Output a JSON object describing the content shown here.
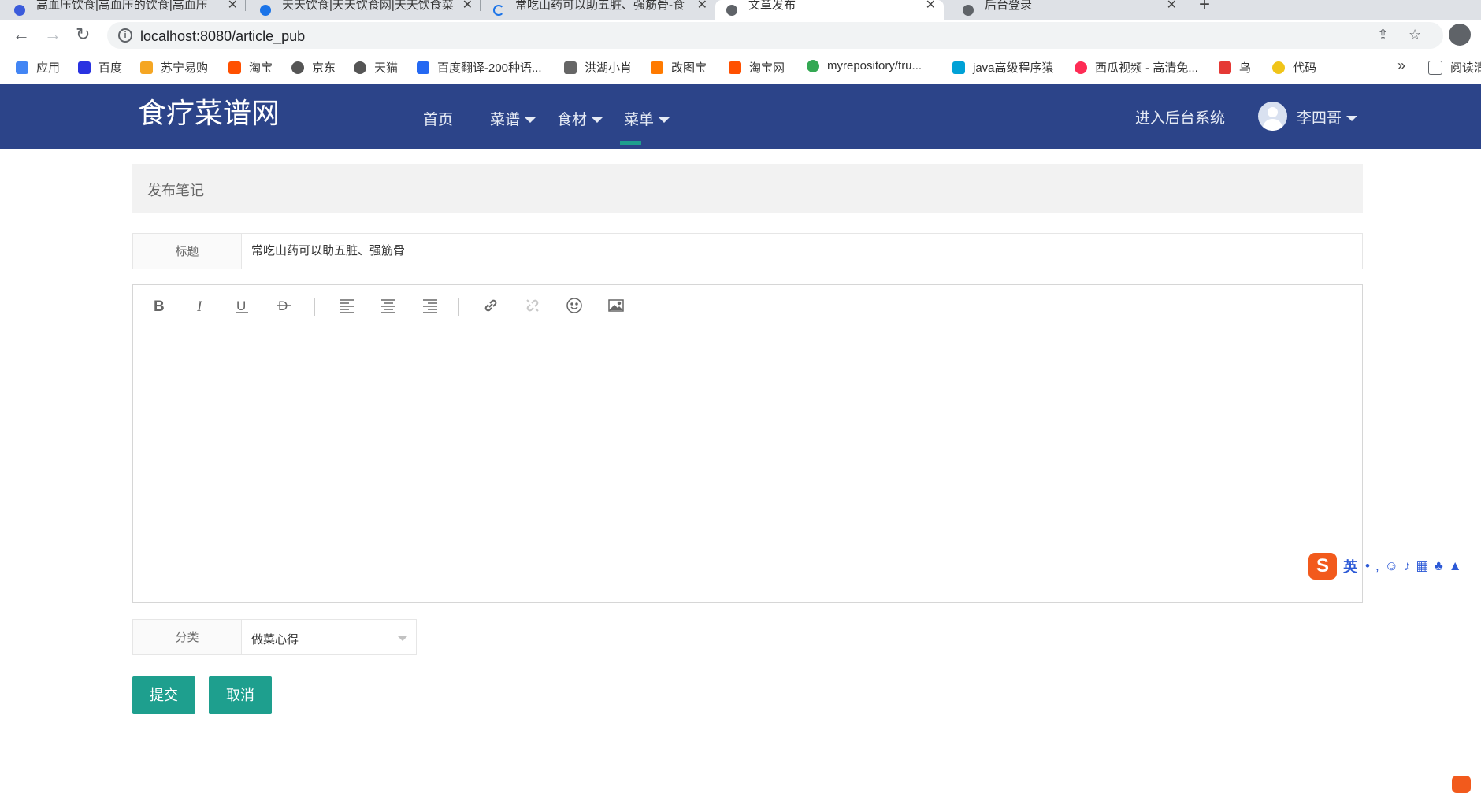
{
  "browser": {
    "tabs": [
      {
        "title": "高血压饮食|高血压的饮食|高血压",
        "icon_color": "#3b5bdb"
      },
      {
        "title": "天天饮食|天天饮食网|天天饮食菜",
        "icon_color": "#1a73e8"
      },
      {
        "title": "常吃山药可以助五脏、强筋骨-食",
        "icon_color": "#1a73e8"
      },
      {
        "title": "文章发布",
        "icon_color": "#5f6368"
      },
      {
        "title": "后台登录",
        "icon_color": "#5f6368"
      }
    ],
    "url": "localhost:8080/article_pub",
    "bookmarks": [
      {
        "label": "应用",
        "color": "#4285f4"
      },
      {
        "label": "百度",
        "color": "#2932e1"
      },
      {
        "label": "苏宁易购",
        "color": "#f5a623"
      },
      {
        "label": "淘宝",
        "color": "#ff5000"
      },
      {
        "label": "京东",
        "color": "#555555"
      },
      {
        "label": "天猫",
        "color": "#555555"
      },
      {
        "label": "百度翻译-200种语...",
        "color": "#2468f2"
      },
      {
        "label": "洪湖小肖",
        "color": "#666666"
      },
      {
        "label": "改图宝",
        "color": "#ff7a00"
      },
      {
        "label": "淘宝网",
        "color": "#ff5000"
      },
      {
        "label": "myrepository/tru...",
        "color": "#34a853"
      },
      {
        "label": "java高级程序猿",
        "color": "#00a1d6"
      },
      {
        "label": "西瓜视频 - 高清免...",
        "color": "#fe2c55"
      },
      {
        "label": "鸟",
        "color": "#e53935"
      },
      {
        "label": "代码",
        "color": "#f0c419"
      },
      {
        "label": "阅读清",
        "color": "#5f6368"
      }
    ]
  },
  "site": {
    "brand": "食疗菜谱网",
    "nav": [
      "首页",
      "菜谱",
      "食材",
      "菜单"
    ],
    "admin_link": "进入后台系统",
    "username": "李四哥",
    "header_color": "#2c4489",
    "accent_color": "#1e9f8e"
  },
  "form": {
    "panel_title": "发布笔记",
    "title_label": "标题",
    "title_value": "常吃山药可以助五脏、强筋骨",
    "category_label": "分类",
    "category_value": "做菜心得",
    "submit_label": "提交",
    "cancel_label": "取消",
    "toolbar_icons": [
      "bold-icon",
      "italic-icon",
      "underline-icon",
      "strikethrough-icon",
      "align-left-icon",
      "align-center-icon",
      "align-right-icon",
      "link-icon",
      "unlink-icon",
      "emoji-icon",
      "image-icon"
    ]
  },
  "ime": {
    "logo": "S",
    "mode": "英"
  }
}
